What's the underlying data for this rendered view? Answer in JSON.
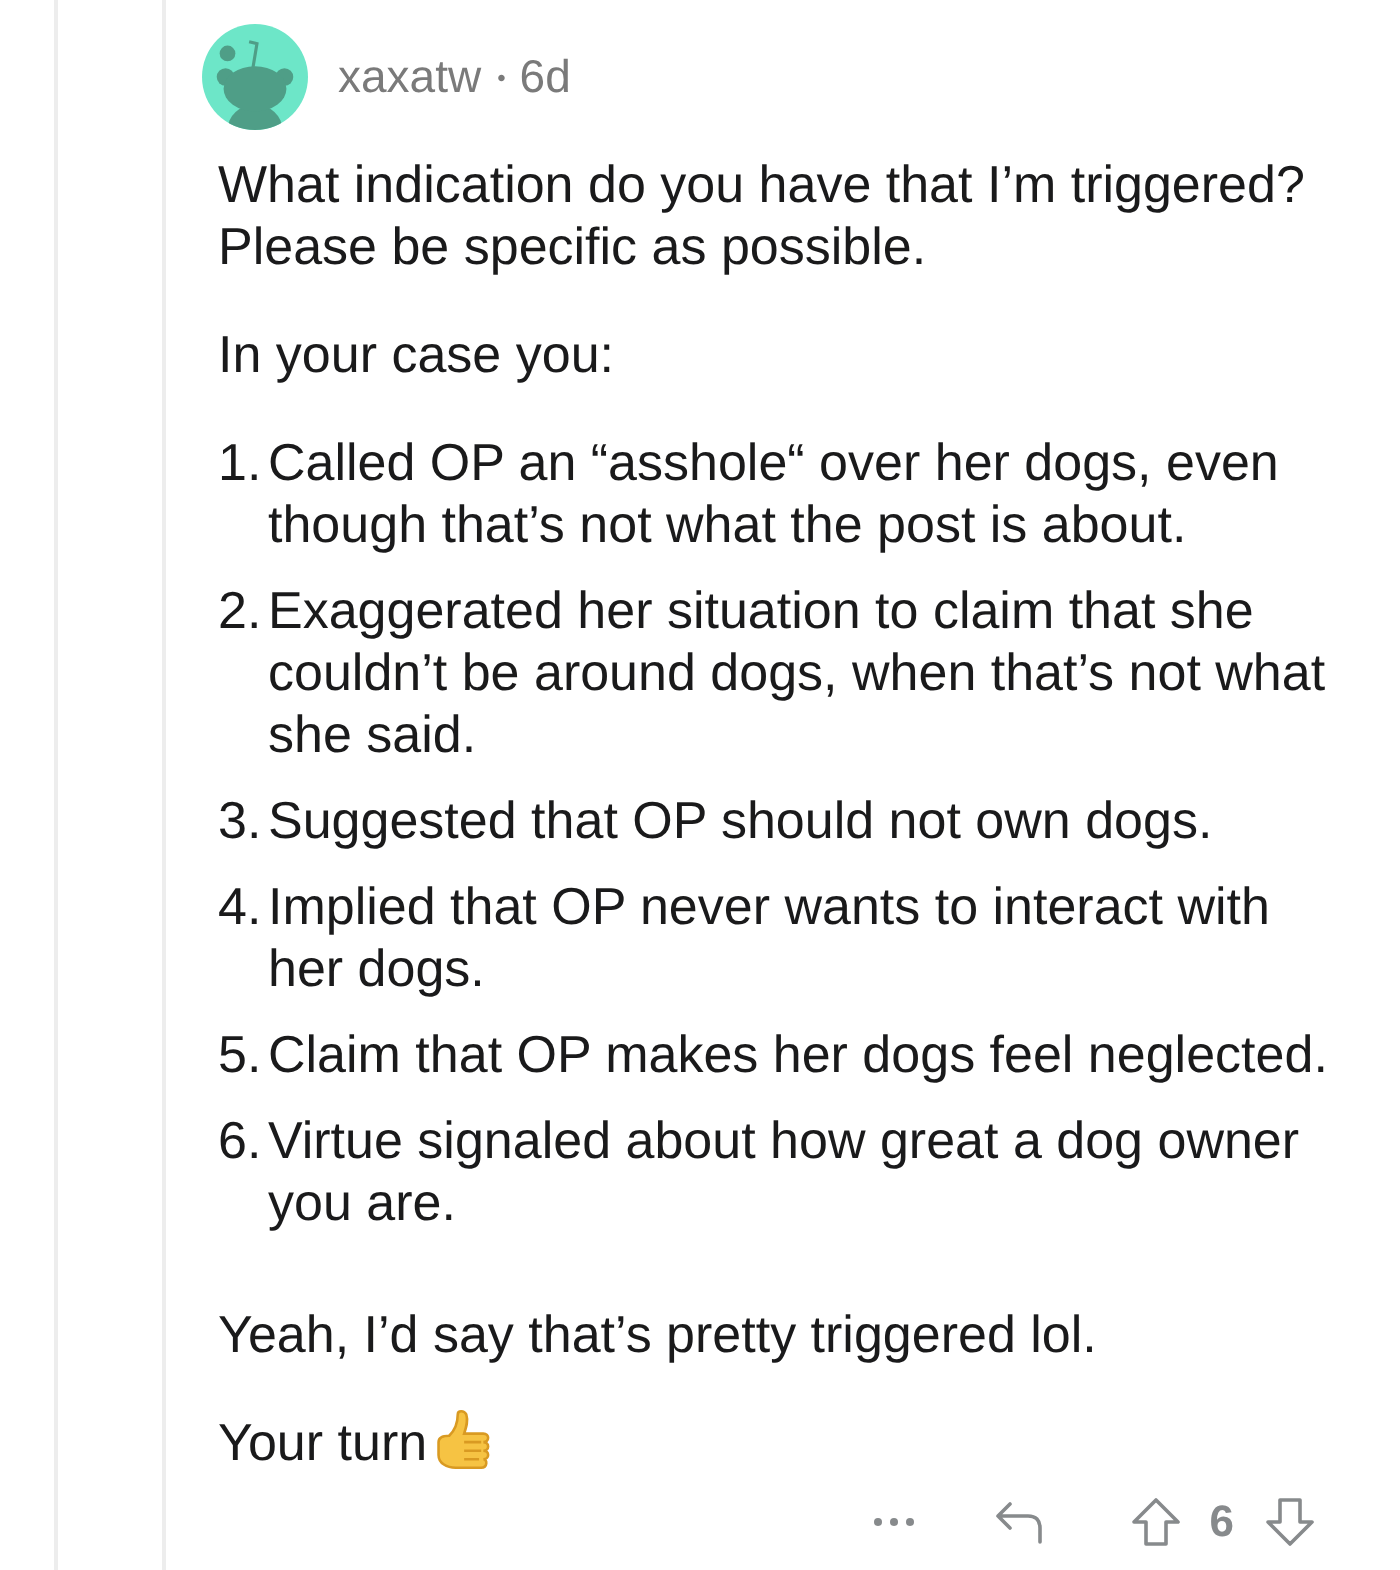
{
  "comment": {
    "author": "xaxatw",
    "separator": "•",
    "age": "6d",
    "body": [
      {
        "kind": "paragraph",
        "text": "What indication do you have that I’m triggered?\nPlease be specific as possible."
      },
      {
        "kind": "paragraph",
        "text": "In your case you:"
      },
      {
        "kind": "list",
        "items": [
          {
            "number": "1.",
            "text": "Called OP an “asshole“ over her dogs, even though that’s not what the post is about."
          },
          {
            "number": "2.",
            "text": "Exaggerated her situation to claim that she couldn’t be around dogs, when that’s not what she said."
          },
          {
            "number": "3.",
            "text": "Suggested that OP should not own dogs."
          },
          {
            "number": "4.",
            "text": "Implied that OP never wants to interact with her dogs."
          },
          {
            "number": "5.",
            "text": "Claim that OP makes her dogs feel neglected."
          },
          {
            "number": "6.",
            "text": "Virtue signaled about how great a dog owner you are."
          }
        ]
      },
      {
        "kind": "paragraph",
        "text": "Yeah, I’d say that’s pretty triggered lol."
      },
      {
        "kind": "reaction",
        "text": "Your turn"
      }
    ]
  },
  "actions": {
    "vote_count": "6"
  }
}
